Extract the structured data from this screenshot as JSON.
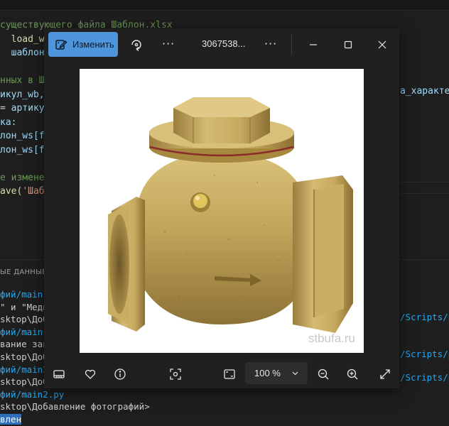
{
  "editor": {
    "code_lines": [
      {
        "segments": [
          {
            "t": "существующего файла Шаблон.xlsx",
            "c": "c-com"
          }
        ]
      },
      {
        "segments": [
          {
            "t": "  ",
            "c": "c-txt"
          },
          {
            "t": "load_wo",
            "c": "c-fn"
          }
        ]
      },
      {
        "segments": [
          {
            "t": "  ",
            "c": "c-txt"
          },
          {
            "t": "шаблон_",
            "c": "c-var"
          }
        ]
      },
      {
        "segments": [
          {
            "t": "",
            "c": "c-txt"
          }
        ]
      },
      {
        "segments": [
          {
            "t": "нных в Ш",
            "c": "c-com"
          }
        ]
      },
      {
        "segments": [
          {
            "t": "икул_wb,",
            "c": "c-var"
          }
        ]
      },
      {
        "segments": [
          {
            "t": "= ",
            "c": "c-txt"
          },
          {
            "t": "артику",
            "c": "c-var"
          }
        ]
      },
      {
        "segments": [
          {
            "t": "ка:",
            "c": "c-var"
          }
        ]
      },
      {
        "segments": [
          {
            "t": "лон_ws[f",
            "c": "c-var"
          }
        ]
      },
      {
        "segments": [
          {
            "t": "лон_ws[f",
            "c": "c-var"
          }
        ]
      },
      {
        "segments": [
          {
            "t": "",
            "c": "c-txt"
          }
        ]
      },
      {
        "segments": [
          {
            "t": "е измене",
            "c": "c-com"
          }
        ]
      },
      {
        "segments": [
          {
            "t": "ave(",
            "c": "c-fn"
          },
          {
            "t": "'Шаб",
            "c": "c-str"
          }
        ]
      }
    ],
    "code_right": "а_характе",
    "panel_tab": "ЫЕ ДАННЫЕ",
    "terminal_lines": [
      {
        "segments": [
          {
            "t": "фий/main.",
            "c": "t-path"
          }
        ]
      },
      {
        "segments": [
          {
            "t": "\" и \"Меди",
            "c": "t-txt"
          }
        ]
      },
      {
        "segments": [
          {
            "t": "sktop\\Доб",
            "c": "t-txt"
          }
        ]
      },
      {
        "segments": [
          {
            "t": "фий/main.",
            "c": "t-path"
          }
        ]
      },
      {
        "segments": [
          {
            "t": "вание зав",
            "c": "t-txt"
          }
        ]
      },
      {
        "segments": [
          {
            "t": "sktop\\Доб",
            "c": "t-txt"
          }
        ]
      },
      {
        "segments": [
          {
            "t": "фий/main2",
            "c": "t-path"
          }
        ]
      },
      {
        "segments": [
          {
            "t": "sktop\\Доб",
            "c": "t-txt"
          }
        ]
      },
      {
        "segments": [
          {
            "t": "фий/main2.py",
            "c": "t-path"
          }
        ]
      },
      {
        "segments": [
          {
            "t": "sktop\\Добавление фотографий>",
            "c": "t-txt"
          }
        ]
      },
      {
        "segments": [
          {
            "t": "влен",
            "c": "t-hl"
          }
        ]
      }
    ],
    "terminal_right": [
      {
        "text": "/Scripts/py"
      },
      {
        "text": "/Scripts/py"
      },
      {
        "text": "/Scripts/py"
      }
    ]
  },
  "viewer": {
    "edit_button_label": "Изменить",
    "filename": "3067538...",
    "watermark": "stbufa.ru",
    "zoom_level": "100 %",
    "icons": {
      "edit": "edit-icon",
      "rotate": "rotate-icon",
      "more": "more-icon",
      "minimize": "minimize-icon",
      "maximize": "maximize-icon",
      "close": "close-icon",
      "filmstrip": "filmstrip-icon",
      "favorite": "heart-icon",
      "info": "info-icon",
      "visual_search": "visual-search-icon",
      "fit": "fit-to-window-icon",
      "zoom_out": "zoom-out-icon",
      "zoom_in": "zoom-in-icon",
      "fullscreen": "fullscreen-icon"
    },
    "colors": {
      "accent": "#4e95dc",
      "window_bg": "#202020"
    }
  }
}
